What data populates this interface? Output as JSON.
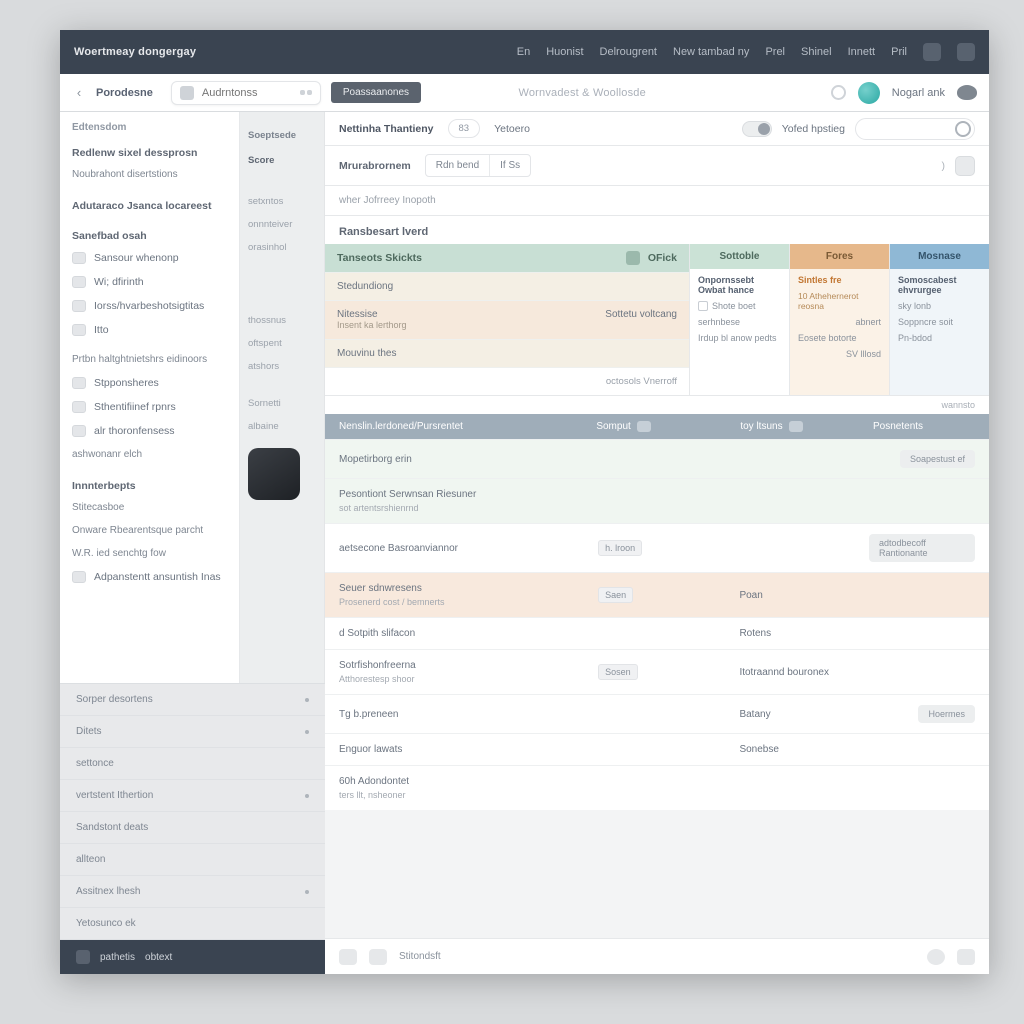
{
  "topbar": {
    "brand": "Woertmeay dongergay",
    "nav": [
      "En",
      "Huonist",
      "Delrougrent",
      "New tambad ny",
      "Prel",
      "Shinel",
      "Innett",
      "Pril"
    ]
  },
  "subbar": {
    "crumb": "Porodesne",
    "search_placeholder": "Audrntonss",
    "primary_btn": "Poassaanones",
    "center_title": "Wornvadest & Woollosde",
    "username": "Nogarl ank"
  },
  "sidebar": {
    "head": "Edtensdom",
    "groups": [
      {
        "title": "Redlenw sixel dessprosn",
        "items": [
          {
            "label": "Noubrahont disertstions"
          }
        ]
      },
      {
        "title": "Adutaraco Jsanca locareest",
        "items": []
      },
      {
        "title_bold": "Sanefbad osah",
        "items": [
          {
            "label": "Sansour whenonp"
          },
          {
            "label": "Wi; dfirinth"
          },
          {
            "label": "Iorss/hvarbeshotsigtitas"
          },
          {
            "label": "Itto"
          }
        ]
      },
      {
        "title": "Prtbn  haltghtnietshrs eidinoors",
        "items": [
          {
            "label": "Stpponsheres"
          },
          {
            "label": "Sthentifiinef rpnrs"
          },
          {
            "label": "alr thoronfensess"
          },
          {
            "label": "ashwonanr elch"
          }
        ]
      },
      {
        "title_bold2": "Innnterbepts",
        "sub": "Stitecasboe",
        "items": [
          {
            "label": "Onware Rbearentsque parcht"
          },
          {
            "label": "W.R. ied senchtg fow"
          },
          {
            "label": "Adpanstentt ansuntish Inas"
          }
        ]
      }
    ]
  },
  "midcol": {
    "groups": [
      {
        "head": "Soeptsede",
        "items": [
          "Score"
        ]
      },
      {
        "head": "",
        "items": [
          "setxntos",
          "onnnteiver",
          "orasinhol"
        ]
      },
      {
        "head": "",
        "items": [
          "thossnus",
          "oftspent",
          "atshors"
        ]
      },
      {
        "head": "",
        "items": [
          "Sornetti",
          "albaine"
        ]
      }
    ],
    "thumb_label": ""
  },
  "mainhead": {
    "title": "Nettinha Thantieny",
    "pill": "83",
    "sublabel": "Yetoero",
    "view_label": "Yofed hpstieg"
  },
  "filterbar": {
    "label": "Mrurabrornem",
    "tabs": [
      "Rdn bend",
      "If Ss"
    ]
  },
  "sectionlead": "wher Jofrreey Inopoth",
  "sectiontitle": "Ransbesart lverd",
  "cards": {
    "big": {
      "head_left": "Tanseots   Skickts",
      "head_right": "OFick",
      "rows": [
        {
          "l": "Stedundiong",
          "r": ""
        },
        {
          "l": "Nitessise",
          "sub": "Insent ka lerthorg",
          "r": "Sottetu voltcang"
        },
        {
          "l": "Mouvinu thes",
          "r": ""
        },
        {
          "l": "",
          "r": "octosols   Vnerroff",
          "cls": "sub"
        }
      ]
    },
    "small": [
      {
        "cls": "green",
        "head": "Sottoble",
        "body_t": "Onpornssebt Owbat hance",
        "line1": "Shote boet",
        "line2": "serhnbese",
        "line3": "Irdup bl anow pedts"
      },
      {
        "cls": "orange",
        "head": "Fores",
        "body_t": "Sintles fre",
        "body_s": "10 Athehernerot reosna",
        "line1": "abnert",
        "line2": "Eosete botorte",
        "line3": "SV lllosd"
      },
      {
        "cls": "blue",
        "head": "Mosnase",
        "body_t": "Somoscabest ehvrurgee",
        "line1": "sky lonb",
        "line2": "Soppncre soit",
        "line3": "Pn-bdod"
      }
    ]
  },
  "smallnote": "wannsto",
  "table": {
    "headers": [
      "Nenslin.lerdoned/Pursrentet",
      "Somput",
      "toy  ltsuns",
      "Posnetents"
    ],
    "rows": [
      {
        "t": "Mopetirborg erin",
        "s": "",
        "c2": "",
        "c3": "",
        "c4": "Soapestust ef",
        "cls": "mint"
      },
      {
        "t": "Pesontiont Serwnsan Riesuner",
        "s": "sot artentsrshienrnd",
        "c2": "",
        "c3": "",
        "c4": "",
        "cls": "mint"
      },
      {
        "t": "aetsecone Basroanviannor",
        "s": "",
        "c2": "h.   lroon",
        "c3": "",
        "c4": "adtodbecoff Rantionante",
        "cls": ""
      },
      {
        "t": "Seuer sdnwresens",
        "s": "Prosenerd cost  /  bemnerts",
        "c2": "Saen",
        "c3": "Poan",
        "c4": "",
        "cls": "peach"
      },
      {
        "t": "d Sotpith slifacon",
        "s": "",
        "c2": "",
        "c3": "Rotens",
        "c4": "",
        "cls": ""
      },
      {
        "t": "Sotrfishonfreerna",
        "s": "Atthorestesp shoor",
        "c2": "Sosen",
        "c3": "Itotraannd bouronex",
        "c4": "",
        "cls": ""
      },
      {
        "t": "Tg b.preneen",
        "s": "",
        "c2": "",
        "c3": "Batany",
        "c4": "Hoermes",
        "cls": ""
      },
      {
        "t": "Enguor lawats",
        "s": "",
        "c2": "",
        "c3": "Sonebse",
        "c4": "",
        "cls": ""
      },
      {
        "t": "60h Adondontet",
        "s": "ters llt, nsheoner",
        "c2": "",
        "c3": "",
        "c4": "",
        "cls": ""
      }
    ]
  },
  "footer": {
    "label": "Stitondsft"
  },
  "leftlower": {
    "items": [
      "Sorper desortens",
      "Ditets",
      "settonce",
      "vertstent Ithertion",
      "Sandstont deats",
      "allteon",
      "Assitnex lhesh",
      "Yetosunco ek"
    ],
    "foot": [
      "pathetis",
      "obtext"
    ]
  }
}
